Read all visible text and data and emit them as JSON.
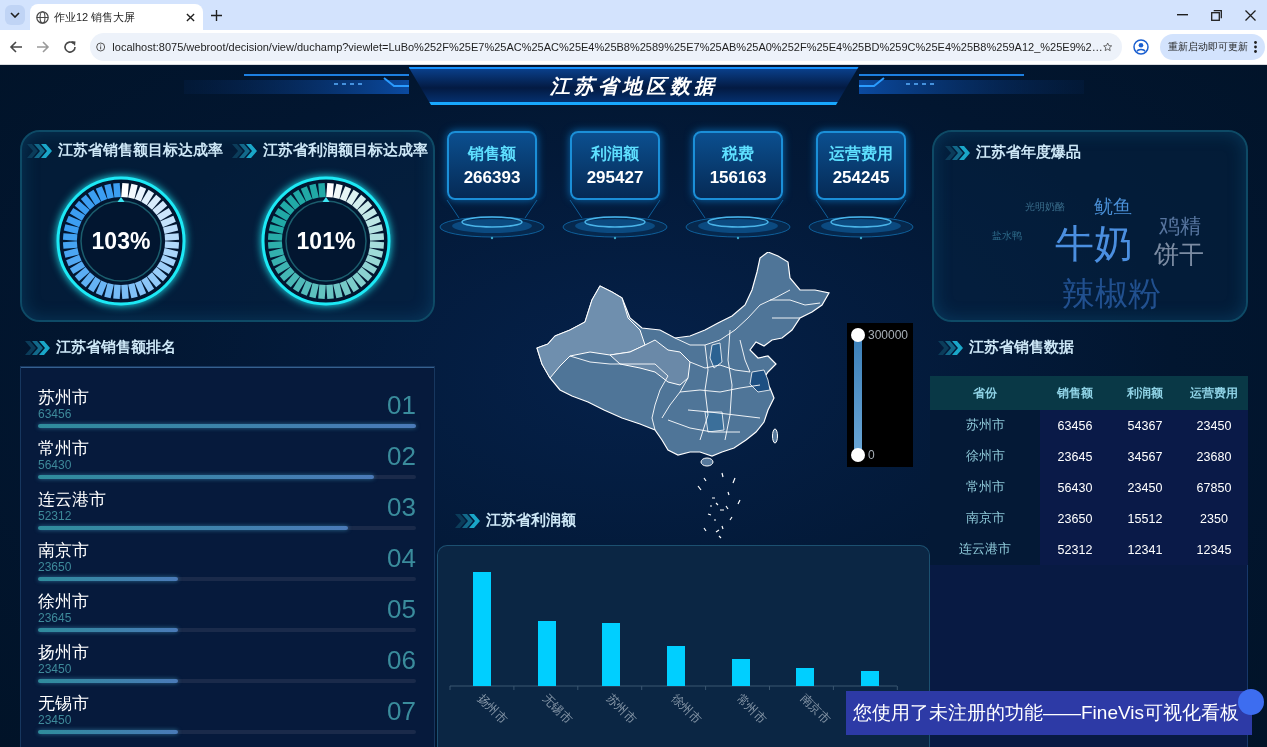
{
  "browser": {
    "tabs": [
      {
        "title": "作业12 销售大屏",
        "selected": true
      }
    ],
    "url": "localhost:8075/webroot/decision/view/duchamp?viewlet=LuBo%252F%25E7%25AC%25AC%25E4%25B8%2589%25E7%25AB%25A0%252F%25E4%25BD%259C%25E4%25B8%259A12_%25E9%2…",
    "update_button": "重新启动即可更新"
  },
  "header": {
    "title": "江苏省地区数据"
  },
  "gauges": [
    {
      "title": "江苏省销售额目标达成率",
      "value": "103%",
      "color": "#3c9ef2"
    },
    {
      "title": "江苏省利润额目标达成率",
      "value": "101%",
      "color": "#21a9a6"
    }
  ],
  "kpis": [
    {
      "label": "销售额",
      "value": "266393"
    },
    {
      "label": "利润额",
      "value": "295427"
    },
    {
      "label": "税费",
      "value": "156163"
    },
    {
      "label": "运营费用",
      "value": "254245"
    }
  ],
  "ranking": {
    "title": "江苏省销售额排名",
    "items": [
      {
        "name": "苏州市",
        "value": "63456",
        "rank": "01",
        "level": 1
      },
      {
        "name": "常州市",
        "value": "56430",
        "rank": "02",
        "level": 0.89
      },
      {
        "name": "连云港市",
        "value": "52312",
        "rank": "03",
        "level": 0.82
      },
      {
        "name": "南京市",
        "value": "23650",
        "rank": "04",
        "level": 0.37
      },
      {
        "name": "徐州市",
        "value": "23645",
        "rank": "05",
        "level": 0.37
      },
      {
        "name": "扬州市",
        "value": "23450",
        "rank": "06",
        "level": 0.37
      },
      {
        "name": "无锡市",
        "value": "23450",
        "rank": "07",
        "level": 0.37
      }
    ]
  },
  "map": {
    "legend_max": "300000",
    "legend_min": "0",
    "handles": [
      {
        "level": 1
      },
      {
        "level": 0
      }
    ]
  },
  "profit_chart": {
    "title": "江苏省利润额",
    "categories": [
      "扬州市",
      "无锡市",
      "苏州市",
      "徐州市",
      "常州市",
      "南京市"
    ]
  },
  "hot_products": {
    "title": "江苏省年度爆品",
    "words": [
      {
        "text": "光明奶酪",
        "color": "#3a6e8c"
      },
      {
        "text": "鱿鱼",
        "color": "#4a8fd6"
      },
      {
        "text": "盐水鸭",
        "color": "#2e6b8a"
      },
      {
        "text": "牛奶",
        "color": "#4b8fe0"
      },
      {
        "text": "鸡精",
        "color": "#56749e"
      },
      {
        "text": "饼干",
        "color": "#7c8ca3"
      },
      {
        "text": "辣椒粉",
        "color": "#21508f"
      }
    ]
  },
  "sales_table": {
    "title": "江苏省销售数据",
    "columns": [
      "省份",
      "销售额",
      "利润额",
      "运营费用"
    ],
    "rows": [
      [
        "苏州市",
        "63456",
        "54367",
        "23450"
      ],
      [
        "徐州市",
        "23645",
        "34567",
        "23680"
      ],
      [
        "常州市",
        "56430",
        "23450",
        "67850"
      ],
      [
        "南京市",
        "23650",
        "15512",
        "2350"
      ],
      [
        "连云港市",
        "52312",
        "12341",
        "12345"
      ]
    ]
  },
  "notice": {
    "text": "您使用了未注册的功能——FineVis可视化看板"
  }
}
